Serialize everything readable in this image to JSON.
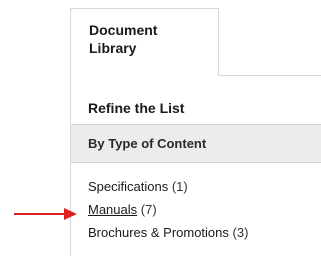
{
  "tab": {
    "label_line1": "Document",
    "label_line2": "Library"
  },
  "refine": {
    "title": "Refine the List"
  },
  "type_filter": {
    "header": "By Type of Content",
    "items": [
      {
        "label": "Specifications",
        "count": "(1)"
      },
      {
        "label": "Manuals",
        "count": "(7)"
      },
      {
        "label": "Brochures & Promotions",
        "count": "(3)"
      }
    ]
  },
  "annotation": {
    "arrow_color": "#e02020",
    "arrow_icon": "arrow-right-icon"
  }
}
